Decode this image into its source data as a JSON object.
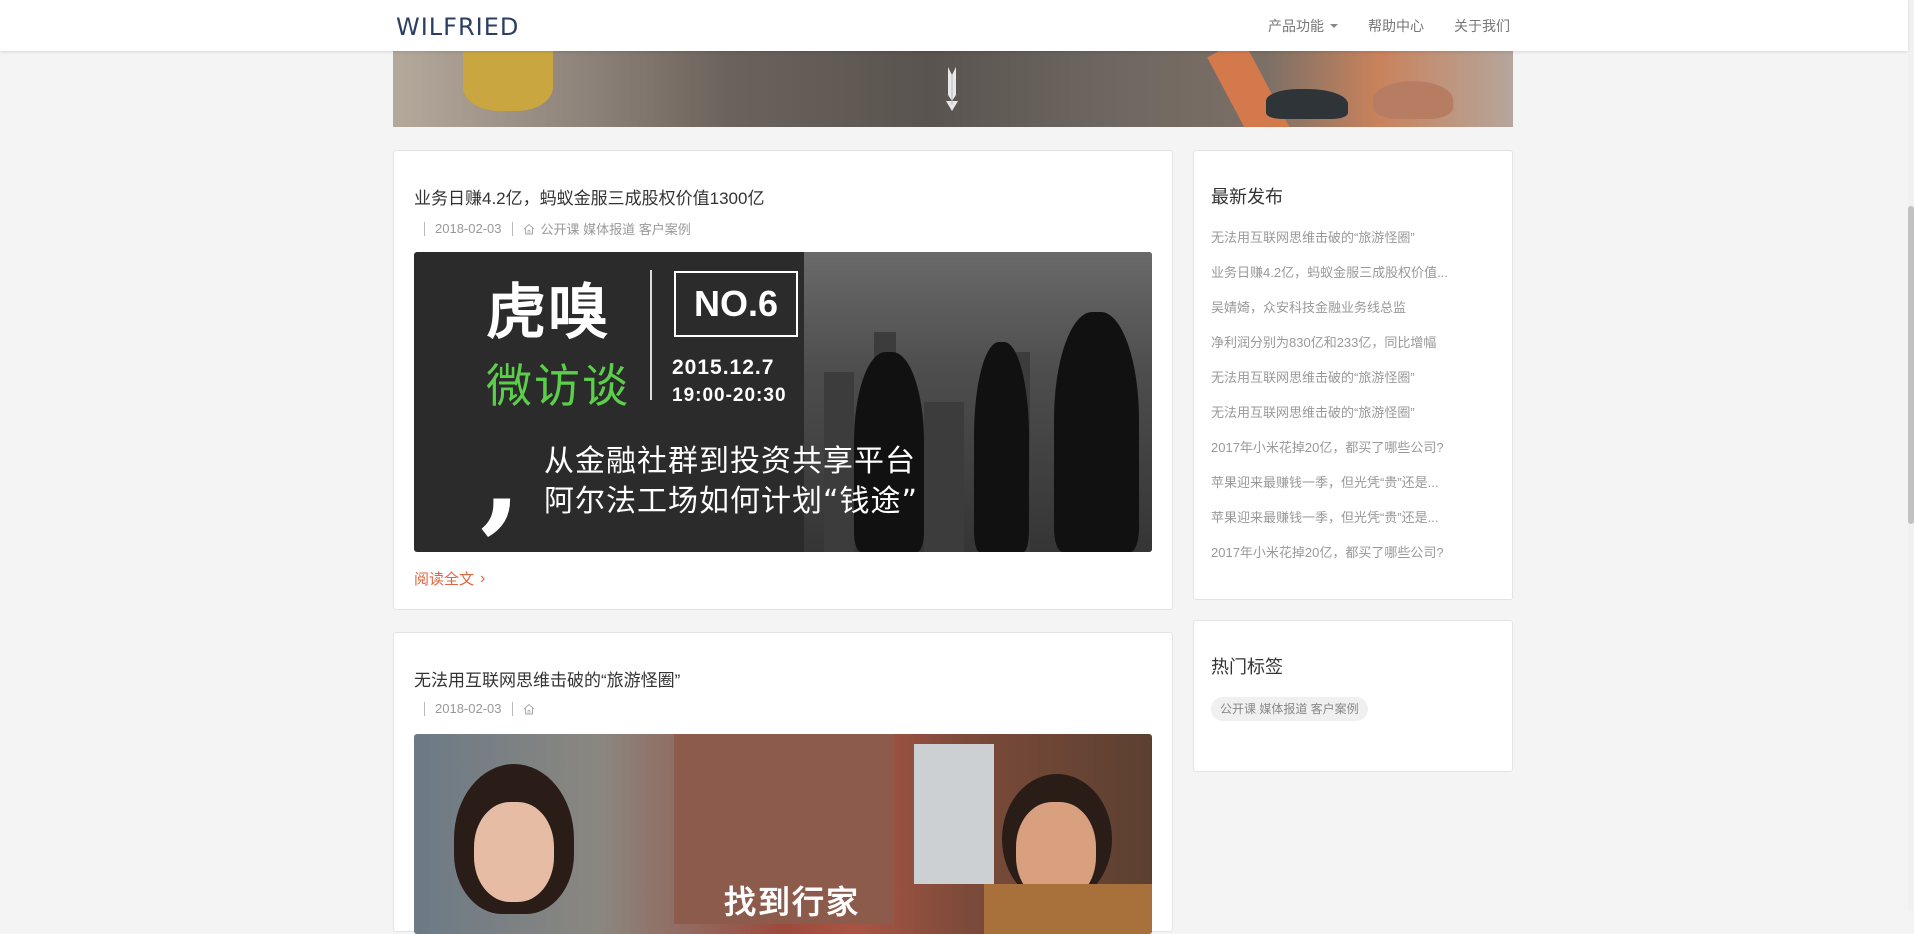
{
  "nav": {
    "brand": "WILFRIED",
    "links": [
      {
        "label": "产品功能",
        "dropdown": true
      },
      {
        "label": "帮助中心"
      },
      {
        "label": "关于我们"
      }
    ]
  },
  "posts": [
    {
      "title": "业务日赚4.2亿，蚂蚁金服三成股权价值1300亿",
      "date": "2018-02-03",
      "tags": "公开课 媒体报道 客户案例",
      "read_more": "阅读全文",
      "image": {
        "brand": "虎嗅",
        "sub": "微访谈",
        "number": "NO.6",
        "date": "2015.12.7",
        "time": "19:00-20:30",
        "line1": "从金融社群到投资共享平台",
        "line2": "阿尔法工场如何计划“钱途”"
      }
    },
    {
      "title": "无法用互联网思维击破的“旅游怪圈”",
      "date": "2018-02-03",
      "tags": "",
      "image": {
        "caption": "找到行家"
      }
    }
  ],
  "sidebar": {
    "recent_title": "最新发布",
    "recent": [
      "无法用互联网思维击破的“旅游怪圈”",
      "业务日赚4.2亿，蚂蚁金服三成股权价值...",
      "吴婧婍，众安科技金融业务线总监",
      "净利润分别为830亿和233亿，同比增幅",
      "无法用互联网思维击破的“旅游怪圈”",
      "无法用互联网思维击破的“旅游怪圈”",
      "2017年小米花掉20亿，都买了哪些公司?",
      "苹果迎来最赚钱一季，但光凭“贵”还是...",
      "苹果迎来最赚钱一季，但光凭“贵”还是...",
      "2017年小米花掉20亿，都买了哪些公司?"
    ],
    "tags_title": "热门标签",
    "tags": [
      "公开课 媒体报道 客户案例"
    ]
  },
  "colors": {
    "accent": "#e0643c",
    "brand": "#2b3f63",
    "green": "#5ccf4a"
  }
}
